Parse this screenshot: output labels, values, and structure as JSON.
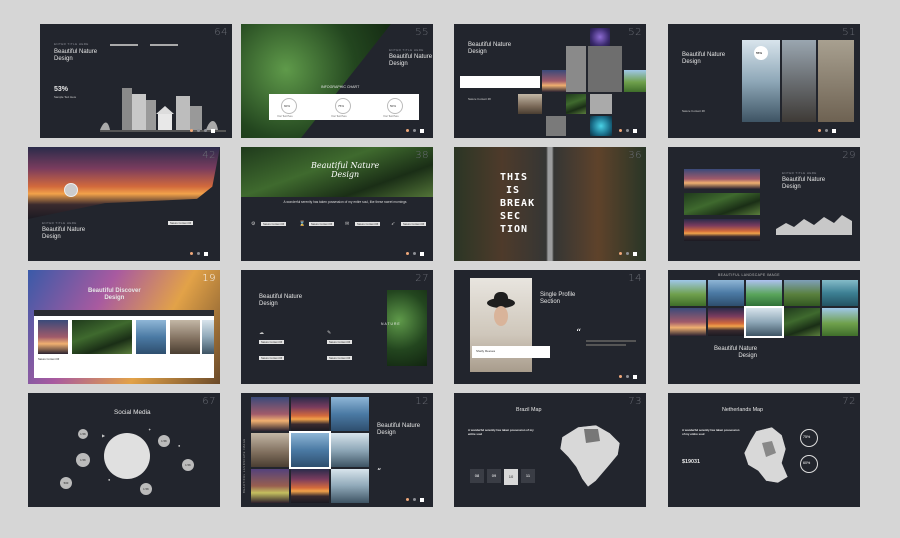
{
  "colors": {
    "background": "#d6d6d6",
    "slide": "#22252d",
    "accent": "#f0a87a"
  },
  "slides": {
    "s1": {
      "num": "64",
      "kicker": "ENTER TITLE HERE",
      "title_1": "Beautiful Nature",
      "title_2": "Design",
      "stat": "53%",
      "stat_label": "Sample Text Here"
    },
    "s2": {
      "num": "55",
      "kicker": "ENTER TITLE HERE",
      "title_1": "Beautiful Nature",
      "title_2": "Design",
      "chart_title": "INFOGRAPHIC CHART",
      "rings": [
        "60%",
        "75%",
        "50%"
      ],
      "ring_labels": [
        "Your Text Here",
        "Your Text Here",
        "Your Text Here"
      ]
    },
    "s3": {
      "num": "52",
      "title_1": "Beautiful Nature",
      "title_2": "Design",
      "caption": "Nature Content ##"
    },
    "s4": {
      "num": "51",
      "title_1": "Beautiful Nature",
      "title_2": "Design",
      "stat": "55%",
      "caption": "Nature Content ##"
    },
    "s5": {
      "num": "42",
      "kicker": "ENTER TITLE HERE",
      "title_1": "Beautiful Nature",
      "title_2": "Design",
      "button": "Nature Content ##"
    },
    "s6": {
      "num": "38",
      "banner_1": "Beautiful Nature",
      "banner_2": "Design",
      "quote": "A wonderful serenity has taken possession of my entire soul, like these sweet mornings",
      "buttons": [
        "Nature Content ##",
        "Nature Content ##",
        "Nature Content ##",
        "Nature Content ##"
      ]
    },
    "s7": {
      "num": "36",
      "lines": [
        "THIS",
        "IS",
        "BREAK",
        "SEC",
        "TION"
      ]
    },
    "s8": {
      "num": "29",
      "kicker": "ENTER TITLE HERE",
      "title_1": "Beautiful Nature",
      "title_2": "Design"
    },
    "s9": {
      "num": "19",
      "title_1": "Beautiful Discover",
      "title_2": "Design",
      "caption": "Nature Content ##"
    },
    "s10": {
      "num": "27",
      "title_1": "Beautiful Nature",
      "title_2": "Design",
      "overlay": "NATURE",
      "buttons": [
        "Nature Content ##",
        "Nature Content ##",
        "Nature Content ##",
        "Nature Content ##"
      ]
    },
    "s11": {
      "num": "14",
      "title_1": "Single Profile",
      "title_2": "Section",
      "name": "Shelly Reeves",
      "quote_mark": "“"
    },
    "s12": {
      "header": "BEAUTIFUL LANDSCAPE IMAGE",
      "title_1": "Beautiful Nature",
      "title_2": "Design"
    },
    "s13": {
      "num": "67",
      "title": "Social Media",
      "stats": [
        "1.5K",
        "1.5K",
        "1.5K",
        "1.5K",
        "500",
        "1.5K"
      ]
    },
    "s14": {
      "num": "12",
      "title_1": "Beautiful Nature",
      "title_2": "Design",
      "vertical": "BEAUTIFUL LANDSCAPE IMAGE",
      "quote_mark": "“"
    },
    "s15": {
      "num": "73",
      "title": "Brazil Map",
      "desc": "A wonderful serenity has taken possession of my entire soul",
      "counts": [
        "08",
        "09",
        "10",
        "11"
      ]
    },
    "s16": {
      "num": "72",
      "title": "Netherlands Map",
      "desc": "A wonderful serenity has taken possession of my entire soul",
      "stat": "$19031",
      "rings": [
        "75%",
        "60%"
      ]
    }
  }
}
